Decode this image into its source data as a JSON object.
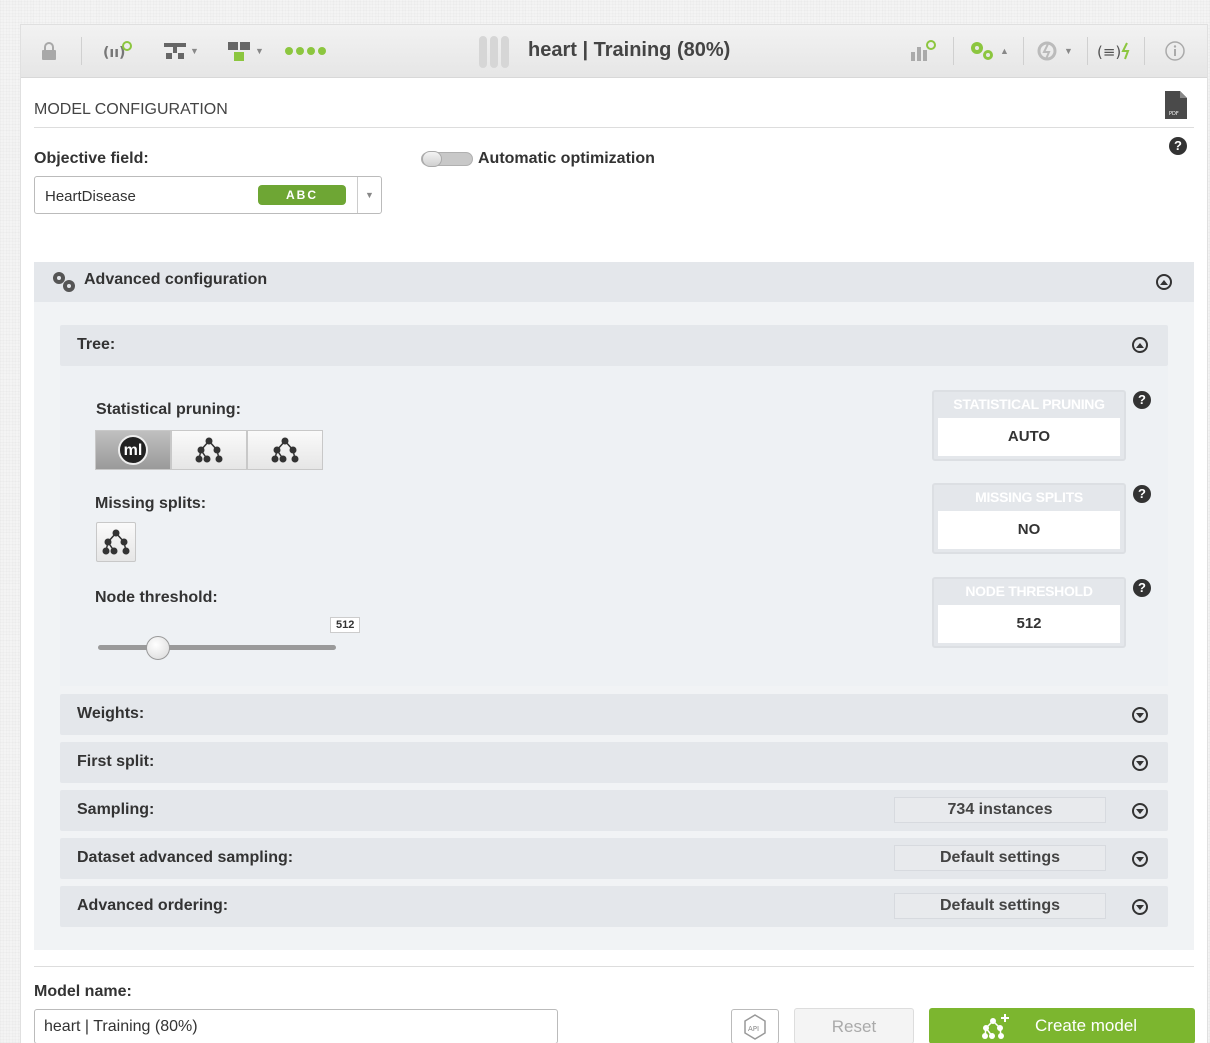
{
  "toolbar": {
    "title": "heart | Training (80%)",
    "icons": [
      "lock-icon",
      "dataset-icon",
      "tree-icon",
      "filter-icon",
      "status-dots",
      "chart-icon",
      "configure-icon",
      "ensemble-icon",
      "formula-icon",
      "info-icon"
    ]
  },
  "header": {
    "section_title": "MODEL CONFIGURATION"
  },
  "objective": {
    "label": "Objective field:",
    "value": "HeartDisease",
    "type_badge": "ABC"
  },
  "optimization": {
    "label": "Automatic optimization",
    "enabled": false
  },
  "advanced": {
    "label": "Advanced configuration",
    "tree": {
      "label": "Tree:",
      "statistical_pruning_label": "Statistical pruning:",
      "statistical_pruning_ml": "ml",
      "missing_splits_label": "Missing splits:",
      "node_threshold_label": "Node threshold:",
      "node_threshold_value": "512"
    },
    "summary": [
      {
        "caption": "STATISTICAL PRUNING",
        "value": "AUTO"
      },
      {
        "caption": "MISSING SPLITS",
        "value": "NO"
      },
      {
        "caption": "NODE THRESHOLD",
        "value": "512"
      }
    ],
    "panels": [
      {
        "label": "Weights:",
        "value": ""
      },
      {
        "label": "First split:",
        "value": ""
      },
      {
        "label": "Sampling:",
        "value": "734 instances"
      },
      {
        "label": "Dataset advanced sampling:",
        "value": "Default settings"
      },
      {
        "label": "Advanced ordering:",
        "value": "Default settings"
      }
    ]
  },
  "footer": {
    "model_name_label": "Model name:",
    "model_name_value": "heart | Training (80%)",
    "api_label": "API",
    "reset_label": "Reset",
    "create_label": "Create model"
  },
  "colors": {
    "accent_green": "#7cb62f",
    "badge_green": "#6ea634"
  }
}
